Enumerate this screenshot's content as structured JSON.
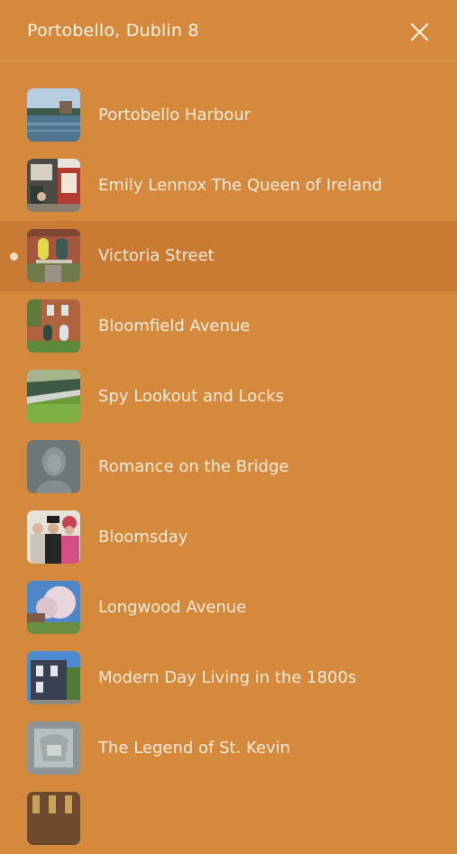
{
  "header": {
    "title": "Portobello, Dublin 8",
    "close_icon": "close-icon"
  },
  "colors": {
    "background": "#d5893d",
    "active_row": "#c97a33",
    "text": "#f8ebdc"
  },
  "list": {
    "active_index": 2,
    "items": [
      {
        "label": "Portobello Harbour",
        "thumbnail": "harbour-photo"
      },
      {
        "label": "Emily Lennox The Queen of Ireland",
        "thumbnail": "shopfront-photo"
      },
      {
        "label": "Victoria Street",
        "thumbnail": "street-door-photo"
      },
      {
        "label": "Bloomfield Avenue",
        "thumbnail": "brick-house-photo"
      },
      {
        "label": "Spy Lookout and Locks",
        "thumbnail": "canal-lock-photo"
      },
      {
        "label": "Romance on the Bridge",
        "thumbnail": "bronze-relief-photo"
      },
      {
        "label": "Bloomsday",
        "thumbnail": "costumed-people-photo"
      },
      {
        "label": "Longwood Avenue",
        "thumbnail": "blossom-tree-photo"
      },
      {
        "label": "Modern Day Living in the 1800s",
        "thumbnail": "terrace-house-photo"
      },
      {
        "label": "The Legend of St. Kevin",
        "thumbnail": "stone-plaque-photo"
      },
      {
        "label": "",
        "thumbnail": "partial-photo"
      }
    ]
  }
}
